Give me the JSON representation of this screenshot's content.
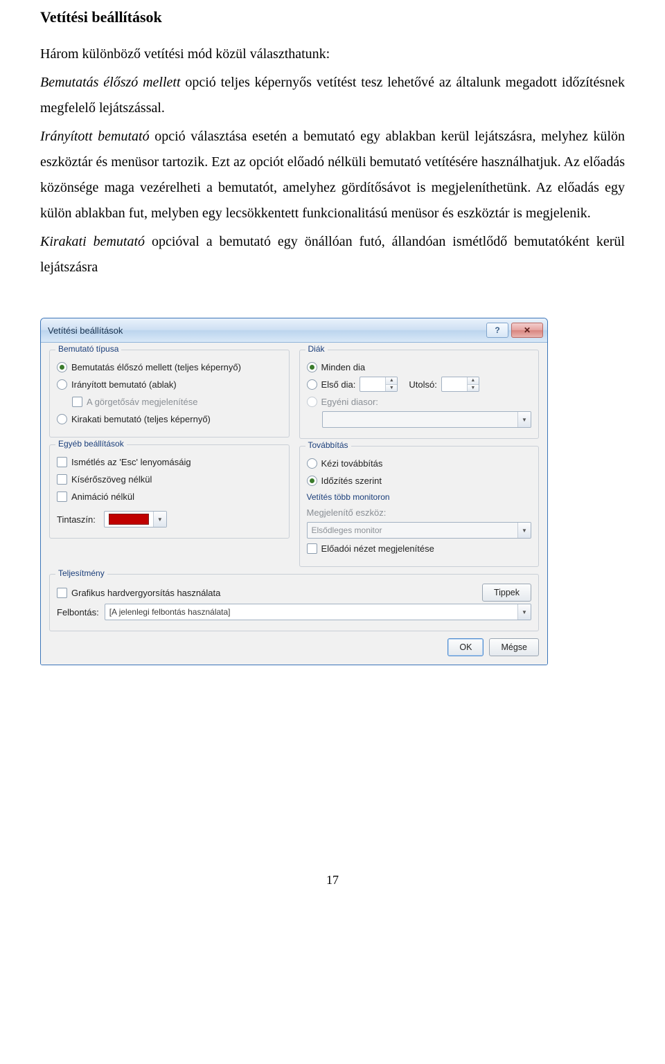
{
  "doc": {
    "heading": "Vetítési beállítások",
    "p1a": "Három különböző vetítési mód közül választhatunk:",
    "p2_it": "Bemutatás élőszó mellett",
    "p2_rest": " opció teljes képernyős vetítést tesz lehetővé az általunk megadott időzítésnek megfelelő lejátszással.",
    "p3_it": "Irányított bemutató",
    "p3_rest": " opció választása esetén a bemutató egy ablakban kerül lejátszásra, melyhez külön eszköztár és menüsor tartozik. Ezt az opciót előadó nélküli bemutató vetítésére használhatjuk. Az előadás közönsége maga vezérelheti a bemutatót, amelyhez gördítősávot is megjeleníthetünk. Az előadás egy külön ablakban fut, melyben egy lecsökkentett funkcionalitású menüsor és eszköztár is megjelenik.",
    "p4_it": "Kirakati bemutató",
    "p4_rest": " opcióval a bemutató egy önállóan futó, állandóan ismétlődő bemutatóként kerül lejátszásra",
    "page_number": "17"
  },
  "dlg": {
    "title": "Vetítési beállítások",
    "help_glyph": "?",
    "close_glyph": "✕",
    "groups": {
      "type": {
        "legend": "Bemutató típusa",
        "opt1": "Bemutatás élőszó mellett (teljes képernyő)",
        "opt2": "Irányított bemutató (ablak)",
        "opt2_chk": "A görgetősáv megjelenítése",
        "opt3": "Kirakati bemutató (teljes képernyő)"
      },
      "other": {
        "legend": "Egyéb beállítások",
        "c1": "Ismétlés az 'Esc' lenyomásáig",
        "c2": "Kísérőszöveg nélkül",
        "c3": "Animáció nélkül",
        "ink_label": "Tintaszín:"
      },
      "slides": {
        "legend": "Diák",
        "all": "Minden dia",
        "from": "Első dia:",
        "to": "Utolsó:",
        "custom": "Egyéni diasor:"
      },
      "advance": {
        "legend": "Továbbítás",
        "o1": "Kézi továbbítás",
        "o2": "Időzítés szerint"
      },
      "monitors": {
        "subhead": "Vetítés több monitoron",
        "device_label": "Megjelenítő eszköz:",
        "device_value": "Elsődleges monitor",
        "presenter_view": "Előadói nézet megjelenítése"
      },
      "perf": {
        "legend": "Teljesítmény",
        "hwaccel": "Grafikus hardvergyorsítás használata",
        "tips_btn": "Tippek",
        "res_label": "Felbontás:",
        "res_value": "[A jelenlegi felbontás használata]"
      }
    },
    "buttons": {
      "ok": "OK",
      "cancel": "Mégse"
    },
    "colors": {
      "ink": "#c00000"
    }
  }
}
